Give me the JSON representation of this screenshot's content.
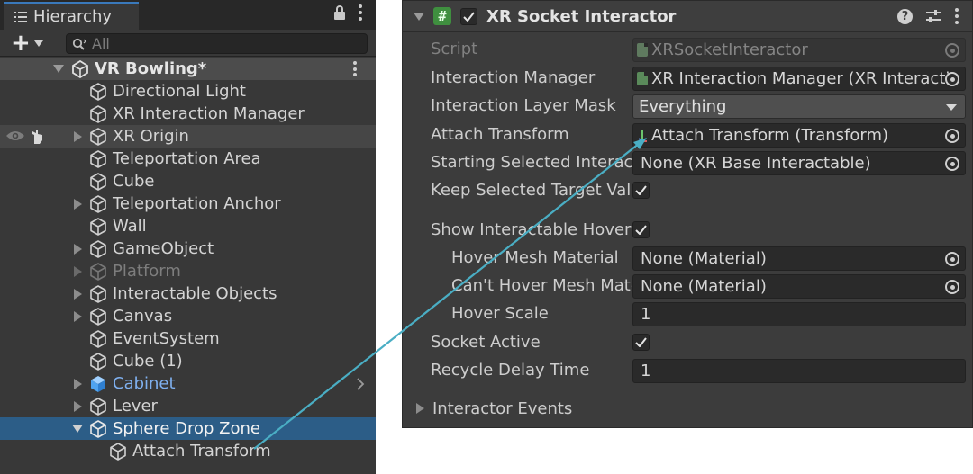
{
  "hierarchy": {
    "tab_label": "Hierarchy",
    "search_placeholder": "All",
    "scene_name": "VR Bowling*",
    "items": [
      {
        "label": "Directional Light"
      },
      {
        "label": "XR Interaction Manager"
      },
      {
        "label": "XR Origin"
      },
      {
        "label": "Teleportation Area"
      },
      {
        "label": "Cube"
      },
      {
        "label": "Teleportation Anchor"
      },
      {
        "label": "Wall"
      },
      {
        "label": "GameObject"
      },
      {
        "label": "Platform"
      },
      {
        "label": "Interactable Objects"
      },
      {
        "label": "Canvas"
      },
      {
        "label": "EventSystem"
      },
      {
        "label": "Cube (1)"
      },
      {
        "label": "Cabinet"
      },
      {
        "label": "Lever"
      },
      {
        "label": "Sphere Drop Zone"
      },
      {
        "label": "Attach Transform"
      }
    ]
  },
  "inspector": {
    "component_title": "XR Socket Interactor",
    "properties": {
      "script": {
        "label": "Script",
        "value": "XRSocketInteractor"
      },
      "interaction_manager": {
        "label": "Interaction Manager",
        "value": "XR Interaction Manager (XR Interacti"
      },
      "interaction_layer_mask": {
        "label": "Interaction Layer Mask",
        "value": "Everything"
      },
      "attach_transform": {
        "label": "Attach Transform",
        "value": "Attach Transform (Transform)"
      },
      "starting_selected": {
        "label": "Starting Selected Interactable",
        "value": "None (XR Base Interactable)"
      },
      "keep_selected": {
        "label": "Keep Selected Target Valid"
      },
      "show_hover": {
        "label": "Show Interactable Hover Meshes"
      },
      "hover_mesh": {
        "label": "Hover Mesh Material",
        "value": "None (Material)"
      },
      "cant_hover_mesh": {
        "label": "Can't Hover Mesh Material",
        "value": "None (Material)"
      },
      "hover_scale": {
        "label": "Hover Scale",
        "value": "1"
      },
      "socket_active": {
        "label": "Socket Active"
      },
      "recycle_delay": {
        "label": "Recycle Delay Time",
        "value": "1"
      }
    },
    "events_label": "Interactor Events"
  },
  "colors": {
    "selection": "#2c5d87",
    "prefab_text": "#7fb0ef",
    "arrow": "#4aaec4",
    "script_icon": "#3f8f3f"
  }
}
